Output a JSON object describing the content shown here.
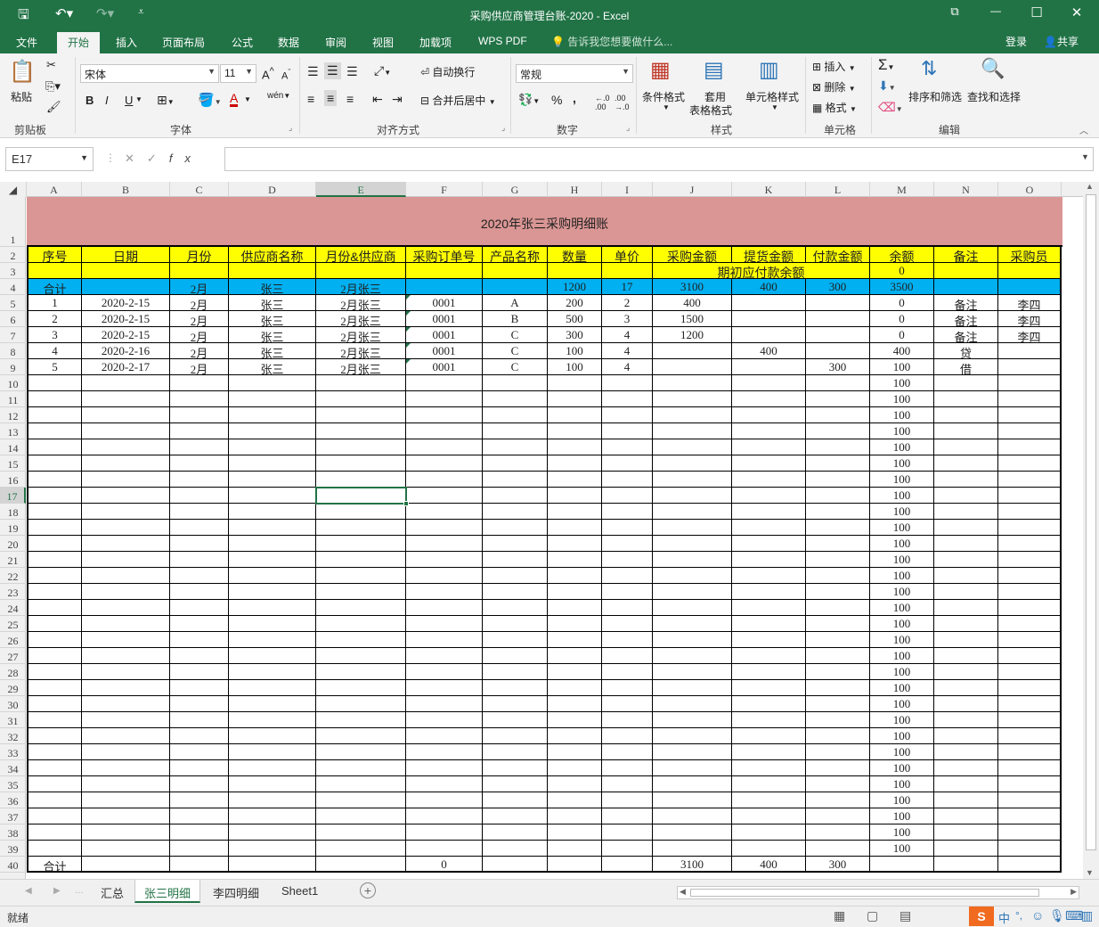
{
  "window": {
    "title": "采购供应商管理台账-2020 - Excel",
    "controls": {
      "restore": "⧉",
      "minimize": "—",
      "maximize": "☐",
      "close": "✕"
    }
  },
  "quick_access": {
    "save_icon": "save-icon",
    "undo_icon": "undo-icon",
    "redo_icon": "redo-icon"
  },
  "ribbon_tabs": [
    "文件",
    "开始",
    "插入",
    "页面布局",
    "公式",
    "数据",
    "审阅",
    "视图",
    "加载项",
    "WPS PDF"
  ],
  "active_tab": "开始",
  "tell_me": "告诉我您想要做什么...",
  "login": "登录",
  "share": "共享",
  "ribbon": {
    "clipboard": {
      "paste": "粘贴",
      "label": "剪贴板"
    },
    "font": {
      "name": "宋体",
      "size": "11",
      "bold": "B",
      "italic": "I",
      "underline": "U",
      "grow": "A",
      "shrink": "A",
      "wen": "wén",
      "label": "字体"
    },
    "alignment": {
      "wrap": "自动换行",
      "merge": "合并后居中",
      "label": "对齐方式"
    },
    "number": {
      "format": "常规",
      "percent": "%",
      "comma": ",",
      "label": "数字"
    },
    "styles": {
      "conditional": "条件格式",
      "table_l1": "套用",
      "table_l2": "表格格式",
      "cell_styles": "单元格样式",
      "label": "样式"
    },
    "cells": {
      "insert": "插入",
      "delete": "删除",
      "format": "格式",
      "label": "单元格"
    },
    "editing": {
      "sort": "排序和筛选",
      "find": "查找和选择",
      "label": "编辑"
    }
  },
  "formula_bar": {
    "name_box": "E17",
    "fx": "fx",
    "formula": ""
  },
  "columns": [
    "A",
    "B",
    "C",
    "D",
    "E",
    "F",
    "G",
    "H",
    "I",
    "J",
    "K",
    "L",
    "M",
    "N",
    "O"
  ],
  "selected_cell": {
    "col": "E",
    "row": 17
  },
  "sheet": {
    "title": "2020年张三采购明细账",
    "headers": [
      "序号",
      "日期",
      "月份",
      "供应商名称",
      "月份&供应商",
      "采购订单号",
      "产品名称",
      "数量",
      "单价",
      "采购金额",
      "提货金额",
      "付款金额",
      "余额",
      "备注",
      "采购员"
    ],
    "opening_label": "期初应付款余额",
    "opening_value": "0",
    "total_row": {
      "A": "合计",
      "C": "2月",
      "D": "张三",
      "E": "2月张三",
      "H": "1200",
      "I": "17",
      "J": "3100",
      "K": "400",
      "L": "300",
      "M": "3500"
    },
    "rows": [
      {
        "A": "1",
        "B": "2020-2-15",
        "C": "2月",
        "D": "张三",
        "E": "2月张三",
        "F": "0001",
        "G": "A",
        "H": "200",
        "I": "2",
        "J": "400",
        "K": "",
        "L": "",
        "M": "0",
        "N": "备注",
        "O": "李四"
      },
      {
        "A": "2",
        "B": "2020-2-15",
        "C": "2月",
        "D": "张三",
        "E": "2月张三",
        "F": "0001",
        "G": "B",
        "H": "500",
        "I": "3",
        "J": "1500",
        "K": "",
        "L": "",
        "M": "0",
        "N": "备注",
        "O": "李四"
      },
      {
        "A": "3",
        "B": "2020-2-15",
        "C": "2月",
        "D": "张三",
        "E": "2月张三",
        "F": "0001",
        "G": "C",
        "H": "300",
        "I": "4",
        "J": "1200",
        "K": "",
        "L": "",
        "M": "0",
        "N": "备注",
        "O": "李四"
      },
      {
        "A": "4",
        "B": "2020-2-16",
        "C": "2月",
        "D": "张三",
        "E": "2月张三",
        "F": "0001",
        "G": "C",
        "H": "100",
        "I": "4",
        "J": "",
        "K": "400",
        "L": "",
        "M": "400",
        "N": "贷",
        "O": ""
      },
      {
        "A": "5",
        "B": "2020-2-17",
        "C": "2月",
        "D": "张三",
        "E": "2月张三",
        "F": "0001",
        "G": "C",
        "H": "100",
        "I": "4",
        "J": "",
        "K": "",
        "L": "300",
        "M": "100",
        "N": "借",
        "O": ""
      }
    ],
    "balance_fill": "100",
    "footer": {
      "A": "合计",
      "F": "0",
      "J": "3100",
      "K": "400",
      "L": "300"
    }
  },
  "sheet_tabs": [
    "汇总",
    "张三明细",
    "李四明细",
    "Sheet1"
  ],
  "active_sheet": "张三明细",
  "add_sheet": "+",
  "status": "就绪",
  "colors": {
    "excel_green": "#217346",
    "title_fill": "#da9694",
    "header_fill": "#ffff00",
    "total_fill": "#00b0f0"
  }
}
